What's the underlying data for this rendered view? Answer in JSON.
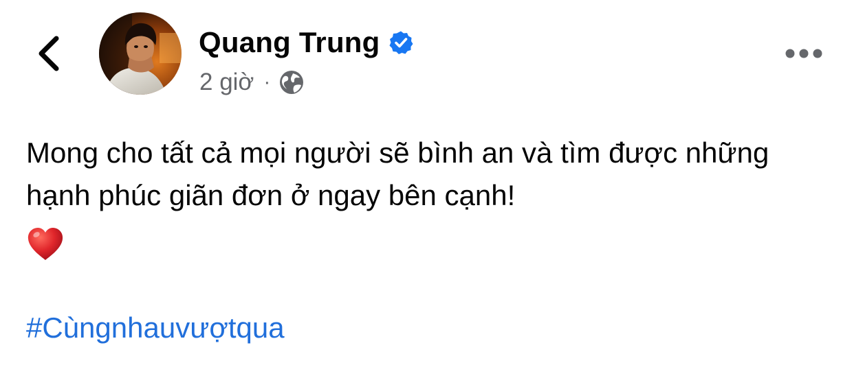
{
  "post_header": {
    "author_name": "Quang Trung",
    "verified_icon": "verified-badge-icon",
    "timestamp": "2 giờ",
    "separator": "·",
    "audience_icon": "globe-icon",
    "back_icon": "chevron-left-icon",
    "more_icon": "more-horizontal-icon"
  },
  "post_body": {
    "lines": [
      "Mong cho tất cả mọi người sẽ bình an và tìm được những",
      "hạnh phúc giãn đơn ở ngay bên cạnh!"
    ],
    "emoji": "heart-emoji",
    "hashtag": "#Cùngnhauvượtqua"
  },
  "colors": {
    "text_primary": "#050505",
    "text_secondary": "#65676b",
    "link": "#216fdb",
    "verified": "#1877f2",
    "heart": "#e0262b"
  }
}
